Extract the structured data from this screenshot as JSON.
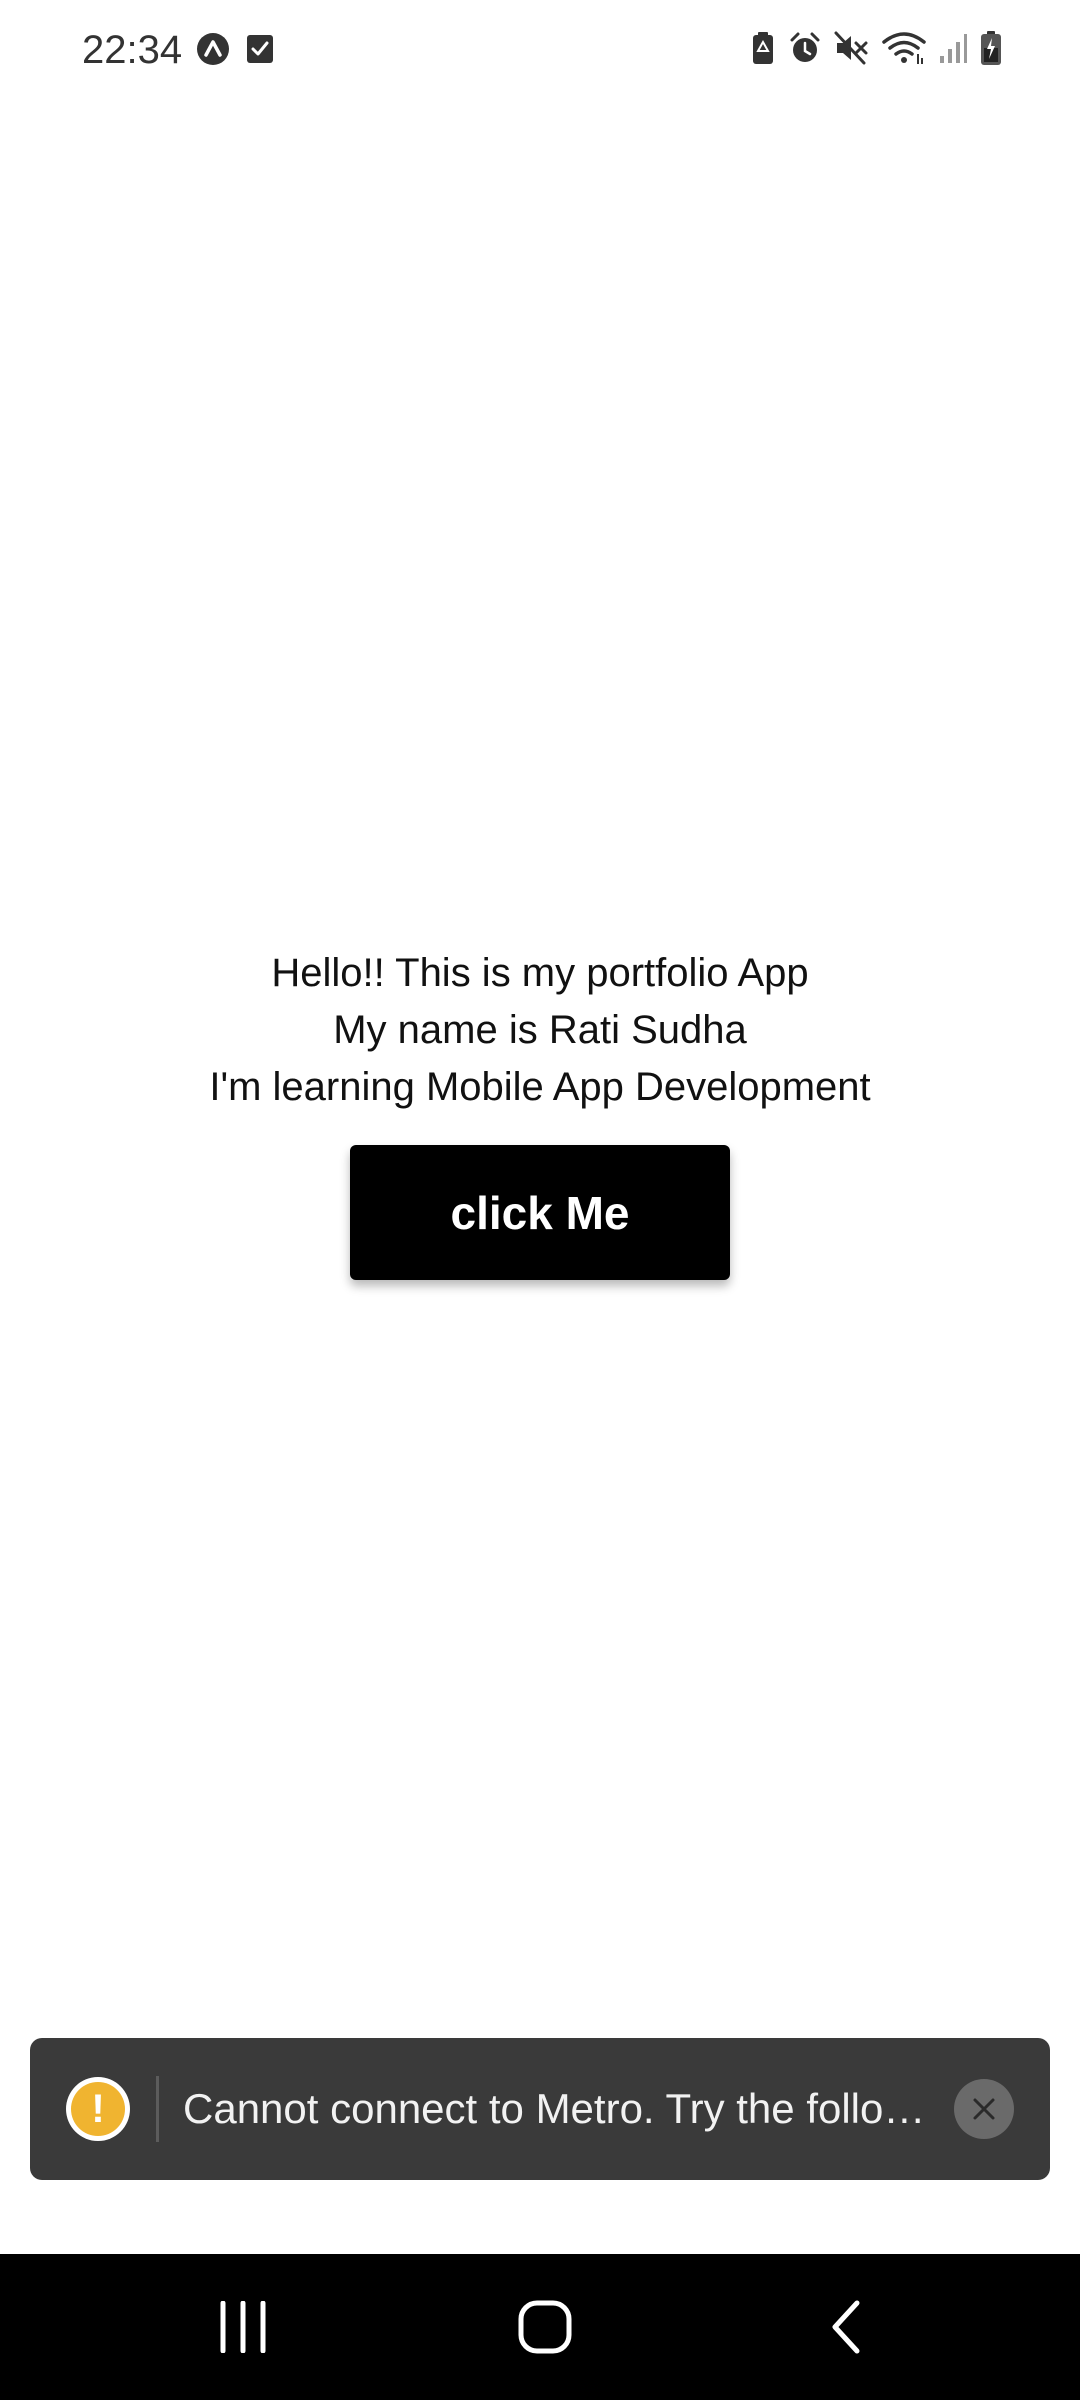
{
  "status_bar": {
    "time": "22:34",
    "left_icons": [
      "expo-icon",
      "checkbox-notification-icon"
    ],
    "right_icons": [
      "battery-saver-icon",
      "alarm-icon",
      "mute-icon",
      "wifi-icon",
      "signal-icon",
      "battery-charging-icon"
    ]
  },
  "main": {
    "lines": [
      "Hello!! This is my portfolio App",
      "My name is Rati Sudha",
      "I'm learning Mobile App Development"
    ],
    "button_label": "click Me"
  },
  "toast": {
    "icon": "warning-icon",
    "icon_glyph": "!",
    "message": "Cannot connect to Metro.  Try the follo…",
    "close_icon": "close-icon",
    "background": "#3a3a3a",
    "warning_color": "#f0b430"
  },
  "nav_bar": {
    "buttons": [
      "recent-apps-icon",
      "home-icon",
      "back-icon"
    ]
  }
}
